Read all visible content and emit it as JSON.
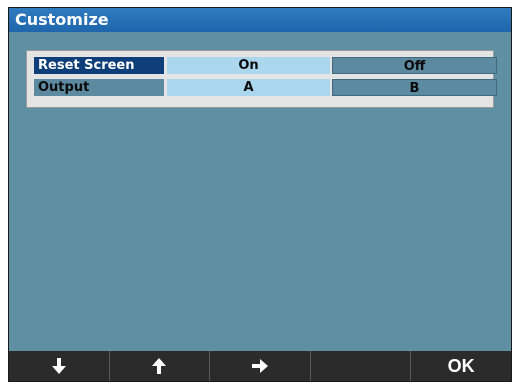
{
  "title": "Customize",
  "settings": [
    {
      "label": "Reset Screen",
      "options": [
        "On",
        "Off"
      ],
      "selected_option": 0,
      "row_selected": true
    },
    {
      "label": "Output",
      "options": [
        "A",
        "B"
      ],
      "selected_option": 0,
      "row_selected": false
    }
  ],
  "softkeys": [
    {
      "icon": "arrow-down-icon"
    },
    {
      "icon": "arrow-up-icon"
    },
    {
      "icon": "arrow-right-icon"
    },
    {
      "icon": ""
    },
    {
      "label": "OK"
    }
  ],
  "colors": {
    "title_bar": "#1f66ad",
    "screen_background": "#5e8fa3",
    "selected_row": "#0f3f7a",
    "active_option": "#aad7ee",
    "softkey_bar": "#2b2b2b"
  }
}
